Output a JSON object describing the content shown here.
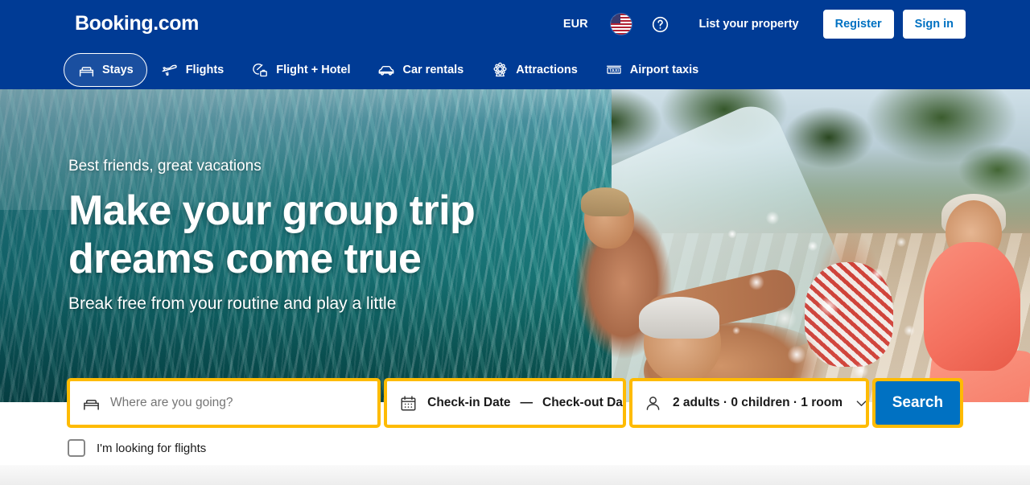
{
  "header": {
    "logo": "Booking.com",
    "currency": "EUR",
    "flag_icon": "us-flag-icon",
    "help_icon": "help-circle-icon",
    "list_property": "List your property",
    "register": "Register",
    "sign_in": "Sign in",
    "background_color": "#003b95"
  },
  "nav": {
    "items": [
      {
        "label": "Stays",
        "icon": "bed-icon",
        "active": true
      },
      {
        "label": "Flights",
        "icon": "airplane-icon",
        "active": false
      },
      {
        "label": "Flight + Hotel",
        "icon": "flight-hotel-icon",
        "active": false
      },
      {
        "label": "Car rentals",
        "icon": "car-icon",
        "active": false
      },
      {
        "label": "Attractions",
        "icon": "ferris-wheel-icon",
        "active": false
      },
      {
        "label": "Airport taxis",
        "icon": "taxi-sign-icon",
        "active": false
      }
    ]
  },
  "hero": {
    "eyebrow": "Best friends, great vacations",
    "title_line1": "Make your group trip",
    "title_line2": "dreams come true",
    "subtitle": "Break free from your routine and play a little",
    "image_description": "Group of older adults laughing and splashing in a swimming pool"
  },
  "search": {
    "destination": {
      "icon": "bed-icon",
      "placeholder": "Where are you going?",
      "value": ""
    },
    "dates": {
      "icon": "calendar-icon",
      "checkin_label": "Check-in Date",
      "separator": "—",
      "checkout_label": "Check-out Date"
    },
    "occupancy": {
      "icon": "person-icon",
      "value": "2 adults · 0 children · 1 room",
      "chevron": "chevron-down-icon"
    },
    "search_button": "Search",
    "border_color": "#febb02",
    "button_color": "#0071c2"
  },
  "options": {
    "flights_checkbox_label": "I'm looking for flights",
    "flights_checkbox_checked": false
  }
}
